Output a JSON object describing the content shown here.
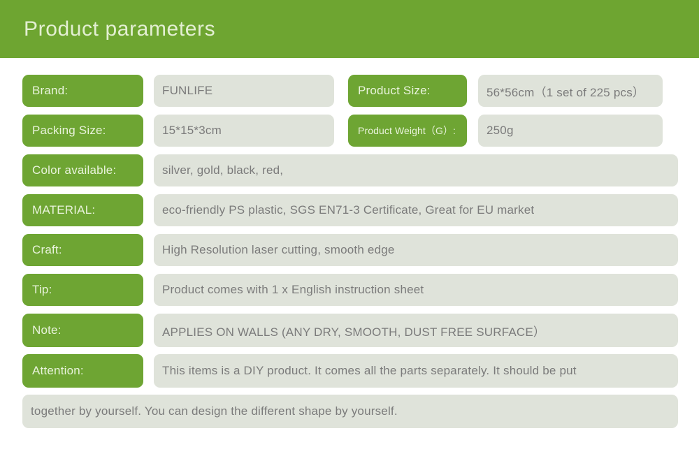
{
  "header": {
    "title": "Product parameters",
    "background_color": "#6ea531",
    "title_color": "#e3efd2"
  },
  "theme": {
    "label_pill_color": "#6ea533",
    "label_text_color": "#e9f3dc",
    "value_pill_color": "#dfe3da",
    "value_text_color": "#7b7b7b",
    "page_background": "#ffffff"
  },
  "rows": [
    {
      "layout": "split",
      "left": {
        "label": "Brand:",
        "value": "FUNLIFE"
      },
      "right": {
        "label": "Product Size:",
        "value": "56*56cm（1 set of 225 pcs）"
      }
    },
    {
      "layout": "split",
      "left": {
        "label": "Packing Size:",
        "value": "15*15*3cm"
      },
      "right": {
        "label": "Product Weight（G）:",
        "value": "250g",
        "label_small": true
      }
    },
    {
      "layout": "full",
      "label": "Color available:",
      "value": "silver, gold, black, red,"
    },
    {
      "layout": "full",
      "label": "MATERIAL:",
      "value": "eco-friendly PS plastic, SGS EN71-3 Certificate, Great for EU market"
    },
    {
      "layout": "full",
      "label": "Craft:",
      "value": "High Resolution laser cutting, smooth edge"
    },
    {
      "layout": "full",
      "label": "Tip:",
      "value": "Product comes with 1 x English instruction sheet"
    },
    {
      "layout": "full",
      "label": "Note:",
      "value": "APPLIES ON WALLS (ANY DRY, SMOOTH, DUST FREE SURFACE）"
    },
    {
      "layout": "full",
      "label": "Attention:",
      "value": "This items is a DIY product. It comes all the parts separately. It should be put"
    },
    {
      "layout": "continuation",
      "value": "together by yourself. You can design the different shape by yourself."
    }
  ]
}
